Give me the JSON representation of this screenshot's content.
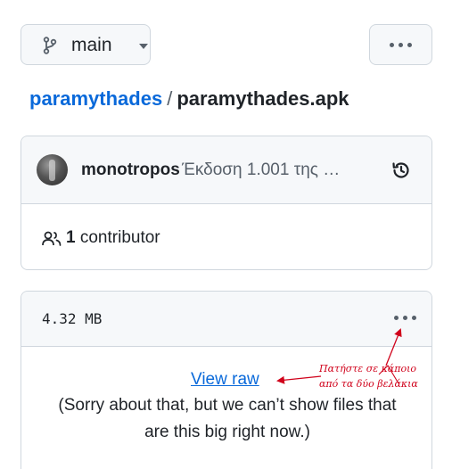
{
  "branch": {
    "label": "main",
    "icon": "git-branch-icon"
  },
  "toolbar": {
    "more_icon": "kebab-horizontal-icon"
  },
  "breadcrumb": {
    "repo": "paramythades",
    "separator": "/",
    "file": "paramythades.apk"
  },
  "commit": {
    "author": "monotropos",
    "message": "Έκδοση 1.001 της …",
    "history_icon": "history-icon"
  },
  "contributors": {
    "count": "1",
    "label": "contributor",
    "icon": "people-icon"
  },
  "file": {
    "size": "4.32 MB",
    "view_raw": "View raw",
    "sorry_line1": "(Sorry about that, but we can’t show files that",
    "sorry_line2": "are this big right now.)"
  },
  "annotation": {
    "line1": "Πατήστε σε κάποιο",
    "line2": "από τα δύο βελάκια",
    "color": "#d0021b"
  },
  "colors": {
    "link": "#0969da",
    "border": "#d0d7de",
    "muted": "#57606a"
  }
}
